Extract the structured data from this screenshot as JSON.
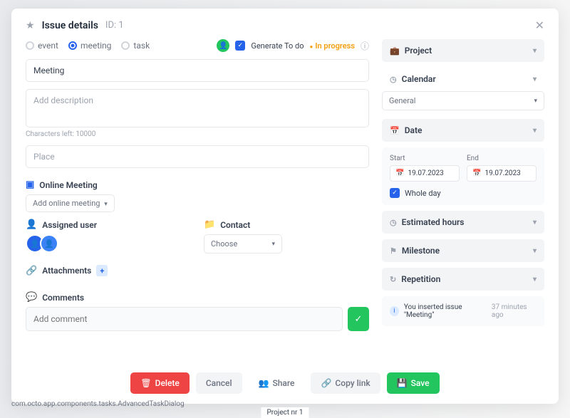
{
  "header": {
    "title": "Issue details",
    "id_label": "ID: 1"
  },
  "types": {
    "event": "event",
    "meeting": "meeting",
    "task": "task",
    "generate_todo": "Generate To do",
    "status": "In progress"
  },
  "inputs": {
    "title_value": "Meeting",
    "description_placeholder": "Add description",
    "chars_left": "Characters left: 10000",
    "place_placeholder": "Place"
  },
  "online_meeting": {
    "title": "Online Meeting",
    "button": "Add online meeting"
  },
  "assigned": {
    "title": "Assigned user"
  },
  "contact": {
    "title": "Contact",
    "choose": "Choose"
  },
  "attachments": {
    "title": "Attachments"
  },
  "comments": {
    "title": "Comments",
    "placeholder": "Add comment"
  },
  "right": {
    "project": "Project",
    "calendar_title": "Calendar",
    "calendar_value": "General",
    "date_title": "Date",
    "start_label": "Start",
    "end_label": "End",
    "start_value": "19.07.2023",
    "end_value": "19.07.2023",
    "whole_day": "Whole day",
    "estimated": "Estimated hours",
    "milestone": "Milestone",
    "repetition": "Repetition"
  },
  "activity": {
    "text": "You inserted issue \"Meeting\"",
    "time": "37 minutes ago"
  },
  "footer": {
    "delete": "Delete",
    "cancel": "Cancel",
    "share": "Share",
    "copy": "Copy link",
    "save": "Save"
  },
  "debug": "com.octo.app.components.tasks.AdvancedTaskDialog",
  "bottom_project": "Project nr 1"
}
